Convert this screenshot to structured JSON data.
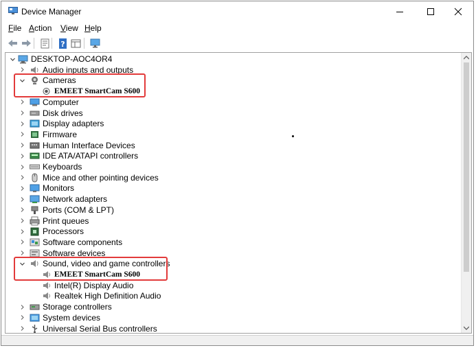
{
  "window": {
    "title": "Device Manager"
  },
  "menu": [
    {
      "id": "file",
      "first": "F",
      "rest": "ile"
    },
    {
      "id": "action",
      "first": "A",
      "rest": "ction"
    },
    {
      "id": "view",
      "first": "V",
      "rest": "iew"
    },
    {
      "id": "help",
      "first": "H",
      "rest": "elp"
    }
  ],
  "toolbar_icons": [
    "back-arrow-icon",
    "forward-arrow-icon",
    "properties-icon",
    "help-icon",
    "grid-view-icon",
    "monitor-scan-icon"
  ],
  "tree": {
    "root": "DESKTOP-AOC4OR4",
    "rows": [
      {
        "key": "audio",
        "label": "Audio inputs and outputs",
        "level": 1,
        "state": "collapsed",
        "icon": "speaker-icon"
      },
      {
        "key": "cameras",
        "label": "Cameras",
        "level": 1,
        "state": "expanded",
        "icon": "camera-icon"
      },
      {
        "key": "cam-device",
        "label": "EMEET SmartCam S600",
        "level": 2,
        "state": "leaf",
        "icon": "webcam-icon",
        "device": true
      },
      {
        "key": "computer",
        "label": "Computer",
        "level": 1,
        "state": "collapsed",
        "icon": "computer-icon"
      },
      {
        "key": "disk",
        "label": "Disk drives",
        "level": 1,
        "state": "collapsed",
        "icon": "disk-drive-icon"
      },
      {
        "key": "display",
        "label": "Display adapters",
        "level": 1,
        "state": "collapsed",
        "icon": "display-adapter-icon"
      },
      {
        "key": "firmware",
        "label": "Firmware",
        "level": 1,
        "state": "collapsed",
        "icon": "firmware-icon"
      },
      {
        "key": "hid",
        "label": "Human Interface Devices",
        "level": 1,
        "state": "collapsed",
        "icon": "hid-icon"
      },
      {
        "key": "ide",
        "label": "IDE ATA/ATAPI controllers",
        "level": 1,
        "state": "collapsed",
        "icon": "ide-controller-icon"
      },
      {
        "key": "keyboards",
        "label": "Keyboards",
        "level": 1,
        "state": "collapsed",
        "icon": "keyboard-icon"
      },
      {
        "key": "mice",
        "label": "Mice and other pointing devices",
        "level": 1,
        "state": "collapsed",
        "icon": "mouse-icon"
      },
      {
        "key": "monitors",
        "label": "Monitors",
        "level": 1,
        "state": "collapsed",
        "icon": "monitor-icon"
      },
      {
        "key": "network",
        "label": "Network adapters",
        "level": 1,
        "state": "collapsed",
        "icon": "network-adapter-icon"
      },
      {
        "key": "ports",
        "label": "Ports (COM & LPT)",
        "level": 1,
        "state": "collapsed",
        "icon": "port-icon"
      },
      {
        "key": "print",
        "label": "Print queues",
        "level": 1,
        "state": "collapsed",
        "icon": "printer-icon"
      },
      {
        "key": "processors",
        "label": "Processors",
        "level": 1,
        "state": "collapsed",
        "icon": "processor-icon"
      },
      {
        "key": "swcomp",
        "label": "Software components",
        "level": 1,
        "state": "collapsed",
        "icon": "software-component-icon"
      },
      {
        "key": "swdev",
        "label": "Software devices",
        "level": 1,
        "state": "collapsed",
        "icon": "software-device-icon"
      },
      {
        "key": "sound",
        "label": "Sound, video and game controllers",
        "level": 1,
        "state": "expanded",
        "icon": "sound-icon"
      },
      {
        "key": "sound-emeet",
        "label": "EMEET SmartCam S600",
        "level": 2,
        "state": "leaf",
        "icon": "speaker-device-icon",
        "device": true
      },
      {
        "key": "sound-intel",
        "label": "Intel(R) Display Audio",
        "level": 2,
        "state": "leaf",
        "icon": "speaker-device-icon"
      },
      {
        "key": "sound-realtek",
        "label": "Realtek High Definition Audio",
        "level": 2,
        "state": "leaf",
        "icon": "speaker-device-icon"
      },
      {
        "key": "storage",
        "label": "Storage controllers",
        "level": 1,
        "state": "collapsed",
        "icon": "storage-controller-icon"
      },
      {
        "key": "sysdev",
        "label": "System devices",
        "level": 1,
        "state": "collapsed",
        "icon": "system-device-icon"
      },
      {
        "key": "usb",
        "label": "Universal Serial Bus controllers",
        "level": 1,
        "state": "collapsed",
        "icon": "usb-icon"
      }
    ]
  },
  "highlights": [
    "cameras",
    "sound"
  ],
  "colors": {
    "highlight_border": "#e23a3a",
    "folder_blue": "#3b8fd8"
  }
}
